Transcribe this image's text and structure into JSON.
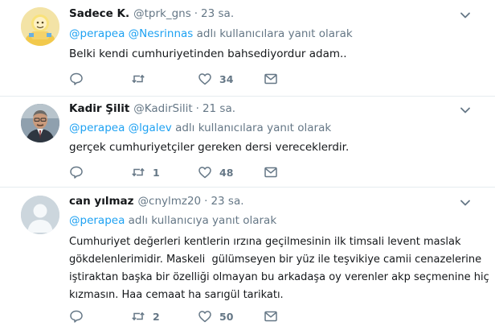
{
  "tweets": [
    {
      "fullname": "Sadece K.",
      "username": "@tprk_gns",
      "dot": "·",
      "time": "23 sa.",
      "mentions": [
        "@perapea",
        "@Nesrinnas"
      ],
      "reply_suffix": "adlı kullanıcılara yanıt olarak",
      "text": "Belki kendi cumhuriyetinden bahsediyordur adam..",
      "reply_count": "",
      "retweet_count": "",
      "like_count": "34",
      "avatar": "cartoon-avatar-yellow"
    },
    {
      "fullname": "Kadir Şilit",
      "username": "@KadirSilit",
      "dot": "·",
      "time": "21 sa.",
      "mentions": [
        "@perapea",
        "@lgalev"
      ],
      "reply_suffix": "adlı kullanıcılara yanıt olarak",
      "text": "gerçek cumhuriyetçiler gereken dersi vereceklerdir.",
      "reply_count": "",
      "retweet_count": "1",
      "like_count": "48",
      "avatar": "photo-avatar-man"
    },
    {
      "fullname": "can yılmaz",
      "username": "@cnylmz20",
      "dot": "·",
      "time": "23 sa.",
      "mentions": [
        "@perapea"
      ],
      "reply_suffix": "adlı kullanıcıya yanıt olarak",
      "text_lines": [
        "Cumhuriyet değerleri kentlerin ırzına geçilmesinin ilk timsali levent maslak",
        "gökdelenlerimidir. Maskeli  gülümseyen bir yüz ile teşvikiye camii cenazelerine",
        "iştiraktan başka bir özelliği olmayan bu arkadaşa oy verenler akp seçmenine hiç",
        "kızmasın. Haa cemaat ha sarıgül tarikatı."
      ],
      "reply_count": "",
      "retweet_count": "2",
      "like_count": "50",
      "avatar": "default-avatar-gray"
    }
  ],
  "icons": {
    "reply": "reply-icon",
    "retweet": "retweet-icon",
    "like": "heart-icon",
    "dm": "envelope-icon",
    "more": "chevron-down-icon"
  },
  "colors": {
    "link": "#1da1f2",
    "secondary": "#657786",
    "text": "#14171a",
    "divider": "#e6ecf0"
  }
}
